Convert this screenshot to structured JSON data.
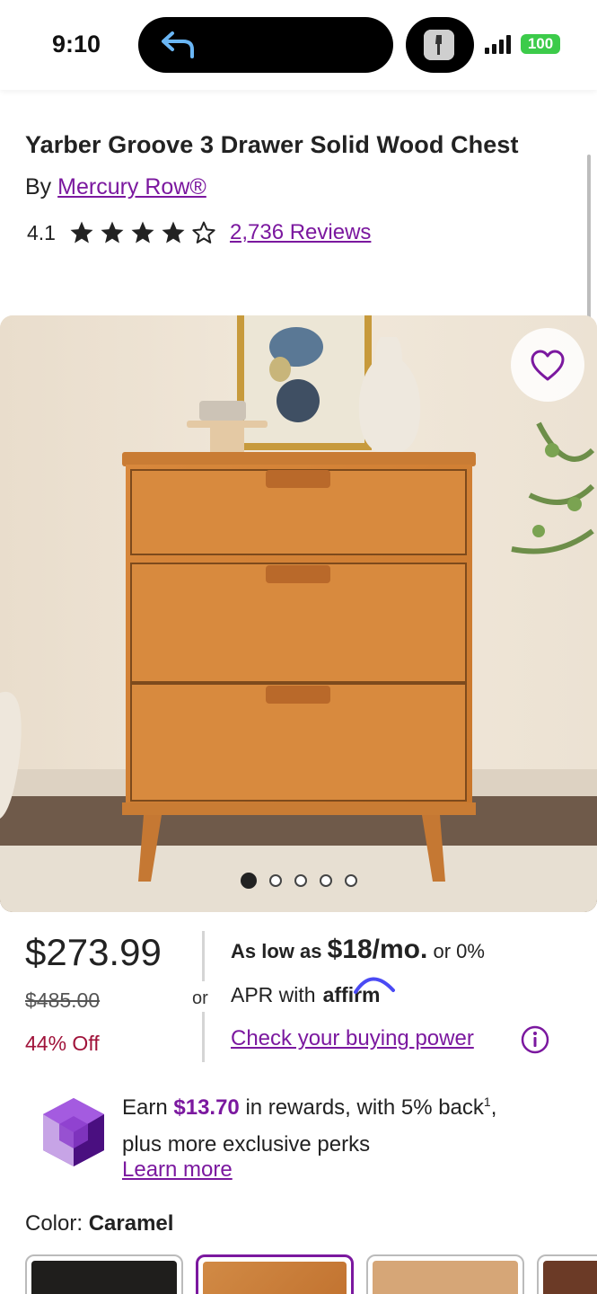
{
  "status_bar": {
    "time": "9:10",
    "battery": "100"
  },
  "product": {
    "title": "Yarber Groove 3 Drawer Solid Wood Chest",
    "by_prefix": "By",
    "brand": "Mercury Row®",
    "rating": "4.1",
    "stars_filled": 4,
    "stars_total": 5,
    "reviews": "2,736 Reviews"
  },
  "gallery": {
    "image_count": 5,
    "active_index": 0
  },
  "pricing": {
    "price": "$273.99",
    "original_price": "$485.00",
    "discount": "44% Off",
    "or": "or",
    "as_low_as": "As low as",
    "monthly": "$18/mo.",
    "or_zero": "or 0%",
    "apr_with": "APR with",
    "affirm": "affirm",
    "check_power": "Check your buying power"
  },
  "rewards": {
    "earn": "Earn",
    "amount": "$13.70",
    "rest": "in rewards, with 5% back",
    "footnote": "1",
    "comma": ",",
    "line2": "plus more exclusive perks",
    "learn_more": "Learn more"
  },
  "color": {
    "label": "Color:",
    "selected": "Caramel"
  },
  "colors": {
    "accent": "#7b189f",
    "discount": "#a0133a"
  }
}
